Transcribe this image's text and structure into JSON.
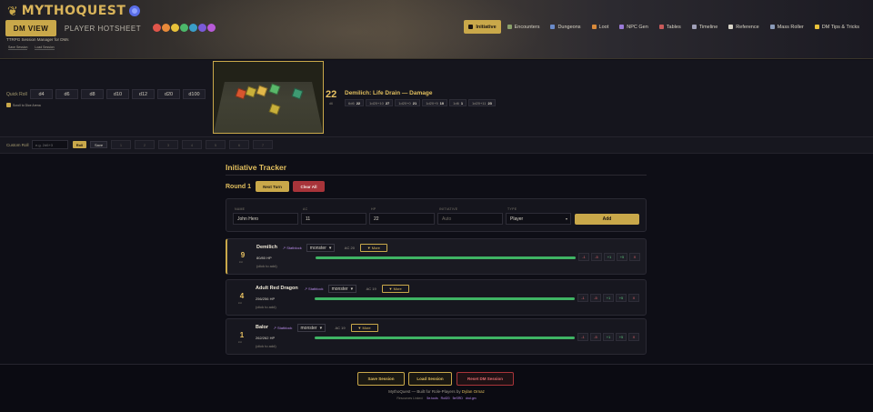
{
  "header": {
    "app_name": "MYTHOQUEST",
    "tagline": "TTRPG Session Manager for DMs",
    "mini_links": [
      "Save Session",
      "Load Session"
    ],
    "view_tabs": [
      {
        "label": "DM VIEW",
        "active": true
      },
      {
        "label": "PLAYER HOTSHEET",
        "active": false
      }
    ],
    "theme_swatches": [
      "#e0554a",
      "#e88a3a",
      "#e8c23a",
      "#4cb86a",
      "#3a9ec8",
      "#7a5ad8",
      "#b85ad8"
    ],
    "nav_tabs": [
      {
        "label": "Initiative",
        "icon": "swords-icon",
        "active": true
      },
      {
        "label": "Encounters",
        "icon": "dragon-icon",
        "active": false
      },
      {
        "label": "Dungeons",
        "icon": "map-icon",
        "active": false
      },
      {
        "label": "Loot",
        "icon": "treasure-icon",
        "active": false
      },
      {
        "label": "NPC Gen",
        "icon": "person-icon",
        "active": false
      },
      {
        "label": "Tables",
        "icon": "table-icon",
        "active": false
      },
      {
        "label": "Timeline",
        "icon": "timeline-icon",
        "active": false
      },
      {
        "label": "Reference",
        "icon": "book-icon",
        "active": false
      },
      {
        "label": "Mass Roller",
        "icon": "dice-icon",
        "active": false
      },
      {
        "label": "DM Tips & Tricks",
        "icon": "lightbulb-icon",
        "active": false
      }
    ]
  },
  "dice": {
    "quick_roll_label": "Quick Roll",
    "dice_buttons": [
      "d4",
      "d6",
      "d8",
      "d10",
      "d12",
      "d20",
      "d100"
    ],
    "scroll_to_dice_label": "Scroll to Dice Arena",
    "result_total": "22",
    "result_sub": "d6",
    "result_title": "Demilich: Life Drain — Damage",
    "result_chips": [
      {
        "label": "6d6",
        "value": "22"
      },
      {
        "label": "1d20+10",
        "value": "27"
      },
      {
        "label": "1d20+0",
        "value": "21"
      },
      {
        "label": "1d20+5",
        "value": "10"
      },
      {
        "label": "1d6",
        "value": "1"
      },
      {
        "label": "1d20+11",
        "value": "23"
      }
    ]
  },
  "custom_roll": {
    "label": "Custom Roll",
    "placeholder": "e.g. 2d6+3",
    "roll_label": "Roll",
    "save_label": "Save",
    "slots": [
      "1",
      "2",
      "3",
      "4",
      "5",
      "6",
      "7"
    ]
  },
  "initiative": {
    "title": "Initiative Tracker",
    "round_label": "Round 1",
    "next_turn_label": "Next Turn",
    "clear_all_label": "Clear All",
    "form": {
      "name_label": "NAME",
      "name_value": "John Hero",
      "ac_label": "AC",
      "ac_value": "11",
      "hp_label": "HP",
      "hp_value": "22",
      "init_label": "INITIATIVE",
      "init_placeholder": "Auto",
      "type_label": "TYPE",
      "type_value": "Player",
      "add_label": "Add"
    },
    "combatants": [
      {
        "init": "9",
        "init_sub": "init",
        "name": "Demilich",
        "statblock": "↗ Statblock",
        "type": "monster",
        "ac": "AC 20",
        "more": "▼ More",
        "hp_text": "80/80 HP",
        "hp_fraction": 1.0,
        "click_hint": "(click to add)",
        "active": true
      },
      {
        "init": "4",
        "init_sub": "init",
        "name": "Adult Red Dragon",
        "statblock": "↗ Statblock",
        "type": "monster",
        "ac": "AC 19",
        "more": "▼ More",
        "hp_text": "256/256 HP",
        "hp_fraction": 1.0,
        "click_hint": "(click to add)",
        "active": false
      },
      {
        "init": "1",
        "init_sub": "init",
        "name": "Balor",
        "statblock": "↗ Statblock",
        "type": "monster",
        "ac": "AC 19",
        "more": "▼ More",
        "hp_text": "262/262 HP",
        "hp_fraction": 1.0,
        "click_hint": "(click to add)",
        "active": false
      }
    ],
    "hp_buttons": [
      "-1",
      "-5",
      "+1",
      "+5",
      "X"
    ]
  },
  "footer": {
    "save_label": "Save Session",
    "load_label": "Load Session",
    "reset_label": "Reset DM Session",
    "credit_prefix": "MythoQuest — Built for Role-Players by",
    "credit_author": "Dylan Ornaz",
    "resources_prefix": "Resources Linked:",
    "resources": [
      "5e.tools",
      "Roll20",
      "5eSRD",
      "dnd.gm"
    ]
  }
}
